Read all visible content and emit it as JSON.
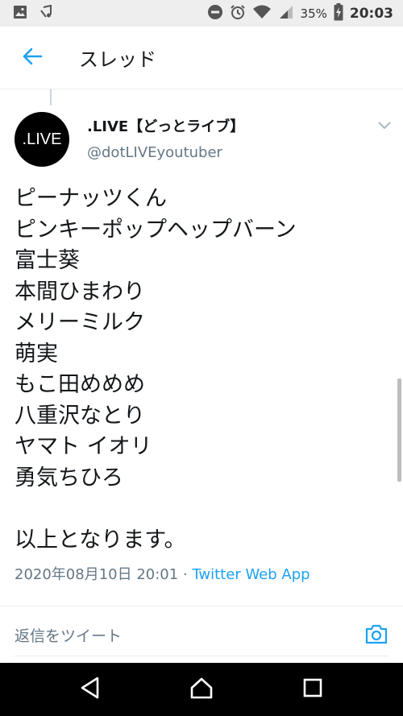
{
  "status_bar": {
    "battery_percent": "35%",
    "time": "20:03",
    "icons": [
      "image-icon",
      "music-icon",
      "do-not-disturb-icon",
      "alarm-icon",
      "wifi-icon",
      "signal-icon",
      "battery-charging-icon"
    ]
  },
  "app_bar": {
    "title": "スレッド",
    "back_icon": "arrow-left-icon"
  },
  "tweet": {
    "avatar_text": ".LIVE",
    "display_name": ".LIVE【どっとライブ】",
    "handle": "@dotLIVEyoutuber",
    "lines": [
      "ピーナッツくん",
      "ピンキーポップヘップバーン",
      "富士葵",
      "本間ひまわり",
      "メリーミルク",
      "萌実",
      "もこ田めめめ",
      "八重沢なとり",
      "ヤマト イオリ",
      "勇気ちひろ",
      "",
      "以上となります。"
    ],
    "timestamp": "2020年08月10日 20:01",
    "separator": " · ",
    "source": "Twitter Web App"
  },
  "reply": {
    "placeholder": "返信をツイート",
    "camera_icon": "camera-icon"
  },
  "colors": {
    "accent": "#1da1f2",
    "secondary_text": "#657786",
    "status_bar_bg": "#eeeeee",
    "nav_bar_bg": "#000000"
  }
}
